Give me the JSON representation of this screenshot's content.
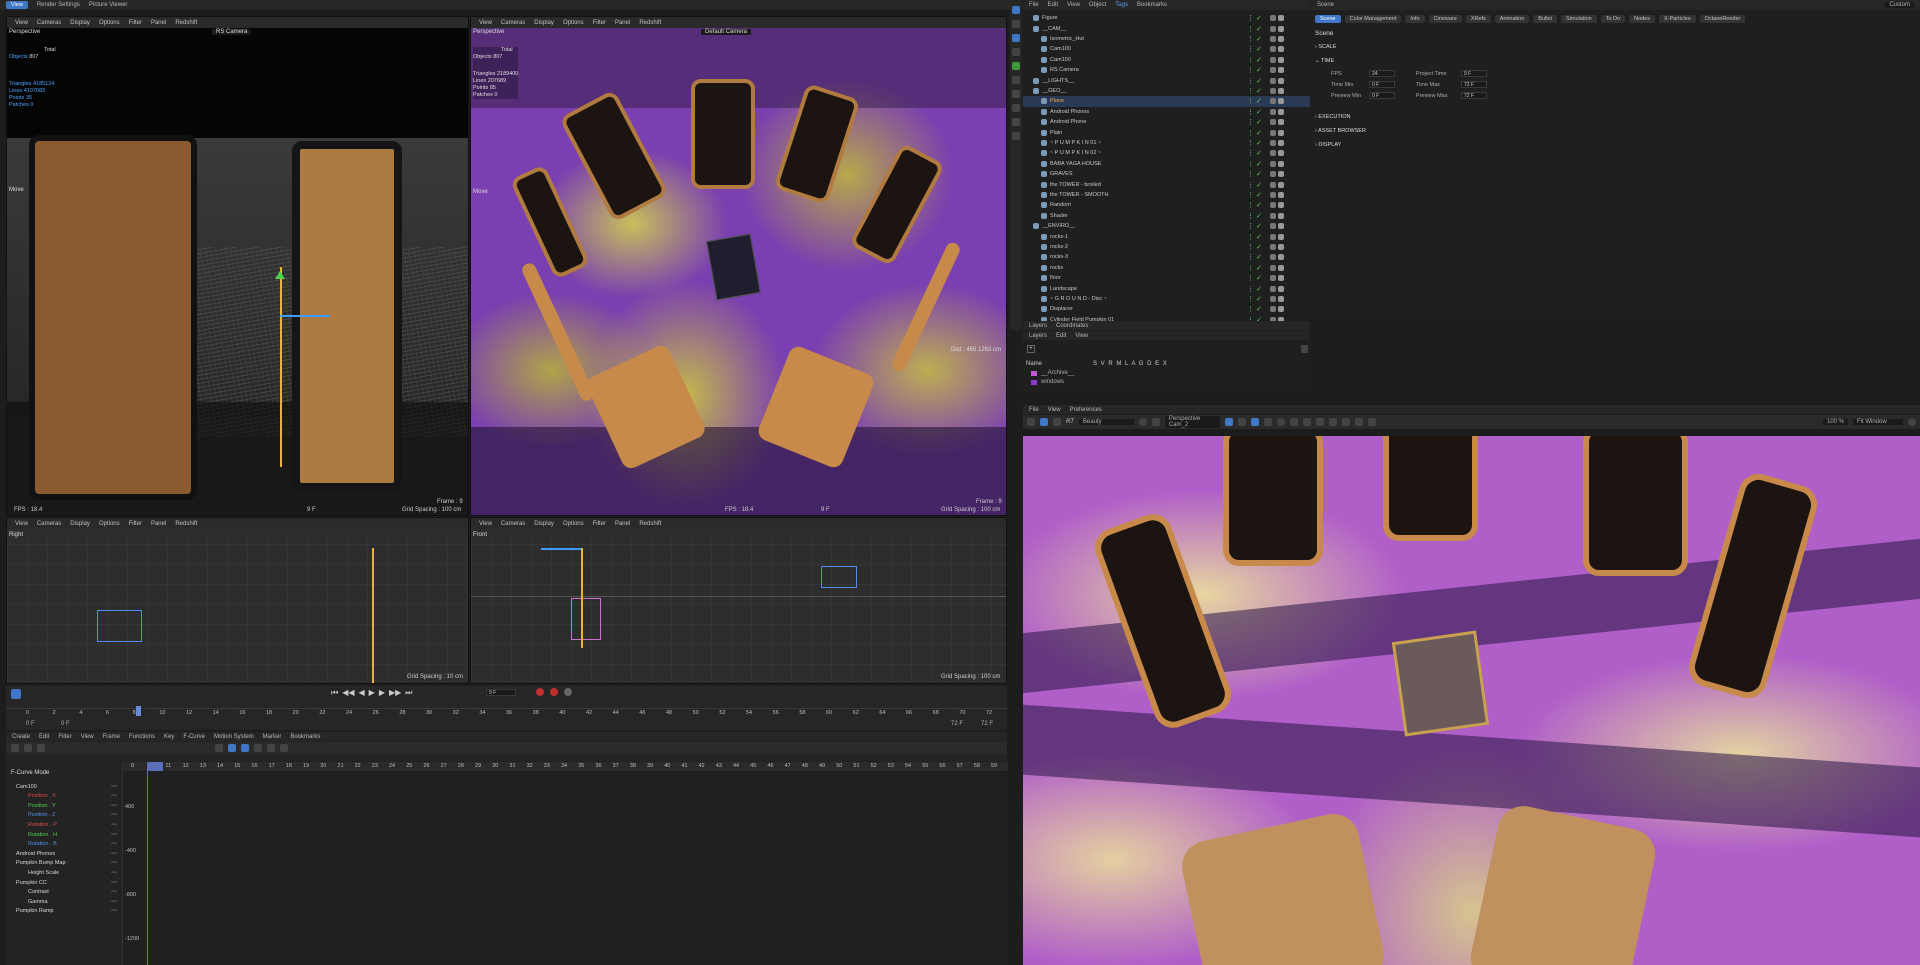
{
  "top_tabs": [
    "View",
    "Render Settings",
    "Picture Viewer"
  ],
  "viewport_menu": [
    "View",
    "Cameras",
    "Display",
    "Options",
    "Filter",
    "Panel",
    "Redshift"
  ],
  "vp_perspective_left": {
    "name": "Perspective",
    "camera": "RS Camera",
    "hud": {
      "total_label": "Total",
      "objects_label": "Objects",
      "objects": "807",
      "triangles_label": "Triangles",
      "triangles": "4185124",
      "lines_label": "Lines",
      "lines": "4107083",
      "points_label": "Points",
      "points": "35",
      "patches_label": "Patches",
      "patches": "0"
    },
    "tool": "Move",
    "fps": "FPS : 18.4",
    "frame_hud": "9 F",
    "grid": "Grid Spacing : 100 cm",
    "frame_right": "Frame : 9"
  },
  "vp_perspective_right": {
    "name": "Perspective",
    "camera": "Default Camera",
    "hud": {
      "total_label": "Total",
      "objects_label": "Objects",
      "objects": "807",
      "triangles_label": "Triangles",
      "triangles": "2189400",
      "lines_label": "Lines",
      "lines": "207689",
      "points_label": "Points",
      "points": "85",
      "patches_label": "Patches",
      "patches": "0"
    },
    "tool": "Move",
    "dist": "Dist : 465.1263 cm",
    "fps": "FPS : 18.4",
    "frame_hud": "9 F",
    "grid": "Grid Spacing : 100 cm",
    "frame_right": "Frame : 9"
  },
  "vp_right": {
    "name": "Right",
    "grid": "Grid Spacing : 10 cm"
  },
  "vp_front": {
    "name": "Front",
    "grid": "Grid Spacing : 100 cm"
  },
  "timeline": {
    "ruler": [
      "0",
      "2",
      "4",
      "6",
      "8",
      "10",
      "12",
      "14",
      "16",
      "18",
      "20",
      "22",
      "24",
      "26",
      "28",
      "30",
      "32",
      "34",
      "36",
      "38",
      "40",
      "42",
      "44",
      "46",
      "48",
      "50",
      "52",
      "54",
      "56",
      "58",
      "60",
      "62",
      "64",
      "66",
      "68",
      "70",
      "72"
    ],
    "current_frame": "9 F",
    "start": "0 F",
    "start2": "0 F",
    "end": "72 F",
    "end2": "72 F"
  },
  "fcurve": {
    "menu": [
      "Create",
      "Edit",
      "Filter",
      "View",
      "Frame",
      "Functions",
      "Key",
      "F-Curve",
      "Motion System",
      "Marker",
      "Bookmarks"
    ],
    "mode": "F-Curve Mode",
    "ruler": [
      "8",
      "10",
      "11",
      "12",
      "13",
      "14",
      "15",
      "16",
      "17",
      "18",
      "19",
      "20",
      "21",
      "22",
      "23",
      "24",
      "25",
      "26",
      "27",
      "28",
      "29",
      "30",
      "31",
      "32",
      "33",
      "34",
      "35",
      "36",
      "37",
      "38",
      "39",
      "40",
      "41",
      "42",
      "43",
      "44",
      "45",
      "46",
      "47",
      "48",
      "49",
      "50",
      "51",
      "52",
      "53",
      "54",
      "55",
      "56",
      "57",
      "58",
      "59"
    ],
    "yvals": [
      "400",
      "-400",
      "-800",
      "-1200"
    ],
    "tracks": [
      {
        "label": "Cam100",
        "color": "#d8d8d8"
      },
      {
        "label": "Position . X",
        "color": "#e04848"
      },
      {
        "label": "Position . Y",
        "color": "#4fd04f"
      },
      {
        "label": "Position . Z",
        "color": "#4f8ef0"
      },
      {
        "label": "Rotation . P",
        "color": "#e04848"
      },
      {
        "label": "Rotation . H",
        "color": "#4fd04f"
      },
      {
        "label": "Rotation . B",
        "color": "#4f8ef0"
      },
      {
        "label": "Android Phones",
        "color": "#d8d8d8"
      },
      {
        "label": "Pumpkin Bump Map",
        "color": "#d8d8d8"
      },
      {
        "label": "Height Scale",
        "color": "#d8d8d8"
      },
      {
        "label": "Pumpkin CC",
        "color": "#d8d8d8"
      },
      {
        "label": "Contrast",
        "color": "#d8d8d8"
      },
      {
        "label": "Gamma",
        "color": "#d8d8d8"
      },
      {
        "label": "Pumpkin Ramp",
        "color": "#d8d8d8"
      }
    ]
  },
  "object_manager": {
    "menu": [
      "File",
      "Edit",
      "View",
      "Object",
      "Tags",
      "Bookmarks"
    ],
    "objects": [
      {
        "name": "Figure",
        "color": "#c9c9c9"
      },
      {
        "name": "__CAM__",
        "color": "#c9c9c9"
      },
      {
        "name": "Isometric_Hut",
        "color": "#c9c9c9"
      },
      {
        "name": "Cam100",
        "color": "#c9c9c9"
      },
      {
        "name": "Cam100",
        "color": "#c9c9c9"
      },
      {
        "name": "RS Camera",
        "color": "#c9c9c9"
      },
      {
        "name": "__LIGHTS__",
        "color": "#c9c9c9"
      },
      {
        "name": "__GEO__",
        "color": "#c9c9c9"
      },
      {
        "name": "Plane",
        "color": "#f2a23c"
      },
      {
        "name": "Android Phones",
        "color": "#c9c9c9"
      },
      {
        "name": "Android Phone",
        "color": "#c9c9c9"
      },
      {
        "name": "Plain",
        "color": "#c9c9c9"
      },
      {
        "name": "~ P U M P K I N 01 ~",
        "color": "#c9c9c9"
      },
      {
        "name": "~ P U M P K I N 02 ~",
        "color": "#c9c9c9"
      },
      {
        "name": "BABA YAGA HOUSE",
        "color": "#c9c9c9"
      },
      {
        "name": "GRAVES",
        "color": "#c9c9c9"
      },
      {
        "name": "the TOWER - broiled",
        "color": "#c9c9c9"
      },
      {
        "name": "the TOWER - SMOOTH",
        "color": "#c9c9c9"
      },
      {
        "name": "Random",
        "color": "#c9c9c9"
      },
      {
        "name": "Shader",
        "color": "#c9c9c9"
      },
      {
        "name": "__ENVIRO__",
        "color": "#c9c9c9"
      },
      {
        "name": "rocks-1",
        "color": "#c9c9c9"
      },
      {
        "name": "rocks-2",
        "color": "#c9c9c9"
      },
      {
        "name": "rocks-3",
        "color": "#c9c9c9"
      },
      {
        "name": "rocks",
        "color": "#c9c9c9"
      },
      {
        "name": "floor",
        "color": "#c9c9c9"
      },
      {
        "name": "Landscape",
        "color": "#c9c9c9"
      },
      {
        "name": "~ G R O U N D - Disc ~",
        "color": "#c9c9c9"
      },
      {
        "name": "Displacer",
        "color": "#c9c9c9"
      },
      {
        "name": "Cylinder Field Pumpkin 01",
        "color": "#c9c9c9"
      }
    ]
  },
  "layers": {
    "tabs": [
      "Layers",
      "Coordinates"
    ],
    "menu": [
      "Layers",
      "Edit",
      "View"
    ],
    "header_name": "Name",
    "header_cols": "S V R M L A G D E X",
    "items": [
      {
        "name": "__Archive__",
        "color": "#c05ad0"
      },
      {
        "name": "windows",
        "color": "#8a3ad0"
      }
    ]
  },
  "attributes": {
    "title": "Scene",
    "tabs": [
      "Scene",
      "Color Management",
      "Info",
      "Cineware",
      "XRefs",
      "Animation",
      "Bullet",
      "Simulation",
      "To Do",
      "Nodes",
      "X-Particles",
      "OctaneRender"
    ],
    "mode": "Custom",
    "heading": "Scene",
    "sections": [
      "SCALE",
      "TIME",
      "EXECUTION",
      "ASSET BROWSER",
      "DISPLAY"
    ],
    "time": {
      "fps_label": "FPS",
      "fps": "24",
      "project_time_label": "Project Time",
      "project_time": "9 F",
      "time_min_label": "Time Min",
      "time_min": "0 F",
      "time_max_label": "Time Max",
      "time_max": "72 F",
      "preview_min_label": "Preview Min",
      "preview_min": "0 F",
      "preview_max_label": "Preview Max",
      "preview_max": "72 F"
    }
  },
  "render_view": {
    "menu": [
      "File",
      "View",
      "Preferences"
    ],
    "aov": "Beauty",
    "camera": "Perspective Cam_2",
    "zoom": "100 %",
    "fit": "Fit Window"
  },
  "colors": {
    "ground_purple": "#7a3fb0",
    "ground_yellow": "#cbc05a",
    "phone_gold": "#c88a4a",
    "phone_screen": "#1b1410",
    "selection_orange": "#f2a23c",
    "accent_blue": "#3f78c6"
  }
}
